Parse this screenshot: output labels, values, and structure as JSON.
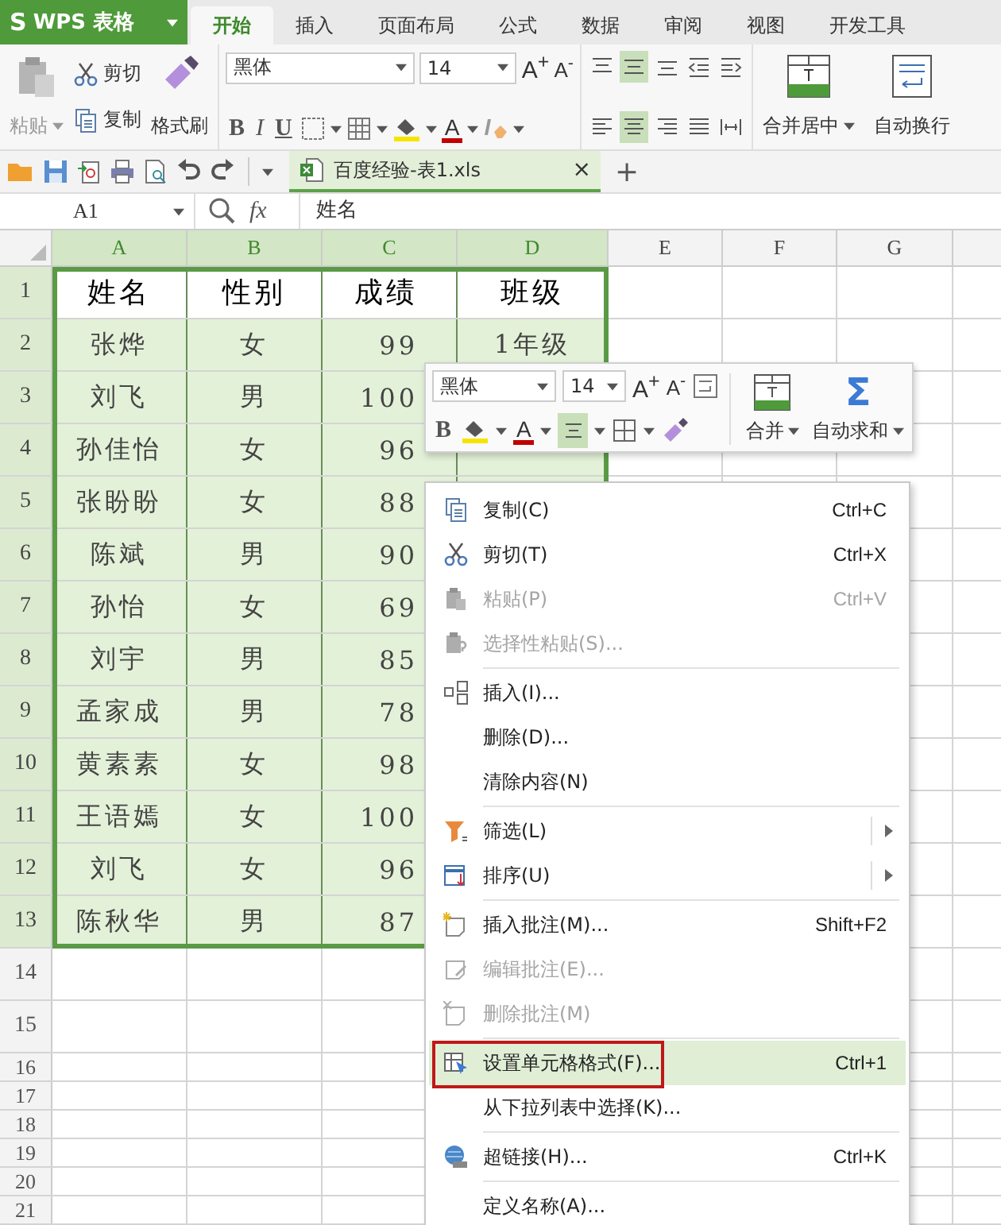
{
  "app_button": {
    "logo": "S",
    "label": "WPS 表格"
  },
  "tabs": [
    {
      "label": "开始",
      "selected": true
    },
    {
      "label": "插入",
      "selected": false
    },
    {
      "label": "页面布局",
      "selected": false
    },
    {
      "label": "公式",
      "selected": false
    },
    {
      "label": "数据",
      "selected": false
    },
    {
      "label": "审阅",
      "selected": false
    },
    {
      "label": "视图",
      "selected": false
    },
    {
      "label": "开发工具",
      "selected": false
    }
  ],
  "ribbon": {
    "paste": {
      "label": "粘贴",
      "disabled": true
    },
    "cut": "剪切",
    "copy": "复制",
    "format_painter": "格式刷",
    "font_name": "黑体",
    "font_size": "14",
    "grow": "A$^{+}$",
    "shrink": "A$^{-}$",
    "bold": "B",
    "italic": "I",
    "underline": "U",
    "font_color": "A",
    "align_top": [
      {
        "selected": false
      },
      {
        "selected": true
      },
      {
        "selected": false
      },
      {
        "selected": false
      },
      {
        "selected": false
      }
    ],
    "align_bottom": [
      {
        "selected": false
      },
      {
        "selected": true
      },
      {
        "selected": false
      },
      {
        "selected": false
      },
      {
        "selected": false
      }
    ],
    "merge": "合并居中",
    "wrap": "自动换行"
  },
  "quick_toolbar": {
    "document_tab": {
      "title": "百度经验-表1.xls",
      "close": "×"
    },
    "new_tab": "+"
  },
  "formula_bar": {
    "cell": "A1",
    "fx": "fx",
    "value": "姓名"
  },
  "sheet": {
    "columns": [
      {
        "label": "A",
        "selected": true
      },
      {
        "label": "B",
        "selected": true
      },
      {
        "label": "C",
        "selected": true
      },
      {
        "label": "D",
        "selected": true
      },
      {
        "label": "E",
        "selected": false
      },
      {
        "label": "F",
        "selected": false
      },
      {
        "label": "G",
        "selected": false
      }
    ],
    "rows": [
      {
        "header": "1",
        "selected": true,
        "kind": "heading",
        "cells": [
          "姓名",
          "性别",
          "成绩",
          "班级"
        ]
      },
      {
        "header": "2",
        "selected": true,
        "kind": "data",
        "cells": [
          "张烨",
          "女",
          "99",
          "1年级"
        ]
      },
      {
        "header": "3",
        "selected": true,
        "kind": "data",
        "cells": [
          "刘飞",
          "男",
          "100"
        ]
      },
      {
        "header": "4",
        "selected": true,
        "kind": "data",
        "cells": [
          "孙佳怡",
          "女",
          "96"
        ]
      },
      {
        "header": "5",
        "selected": true,
        "kind": "data",
        "cells": [
          "张盼盼",
          "女",
          "88"
        ]
      },
      {
        "header": "6",
        "selected": true,
        "kind": "data",
        "cells": [
          "陈斌",
          "男",
          "90"
        ]
      },
      {
        "header": "7",
        "selected": true,
        "kind": "data",
        "cells": [
          "孙怡",
          "女",
          "69"
        ]
      },
      {
        "header": "8",
        "selected": true,
        "kind": "data",
        "cells": [
          "刘宇",
          "男",
          "85"
        ]
      },
      {
        "header": "9",
        "selected": true,
        "kind": "data",
        "cells": [
          "孟家成",
          "男",
          "78"
        ]
      },
      {
        "header": "10",
        "selected": true,
        "kind": "data",
        "cells": [
          "黄素素",
          "女",
          "98"
        ]
      },
      {
        "header": "11",
        "selected": true,
        "kind": "data",
        "cells": [
          "王语嫣",
          "女",
          "100"
        ]
      },
      {
        "header": "12",
        "selected": true,
        "kind": "data",
        "cells": [
          "刘飞",
          "女",
          "96"
        ]
      },
      {
        "header": "13",
        "selected": true,
        "kind": "data",
        "cells": [
          "陈秋华",
          "男",
          "87"
        ]
      },
      {
        "header": "14",
        "selected": false,
        "kind": "tall"
      },
      {
        "header": "15",
        "selected": false,
        "kind": "tall"
      },
      {
        "header": "16",
        "selected": false,
        "kind": "short"
      },
      {
        "header": "17",
        "selected": false,
        "kind": "short"
      },
      {
        "header": "18",
        "selected": false,
        "kind": "short"
      },
      {
        "header": "19",
        "selected": false,
        "kind": "short"
      },
      {
        "header": "20",
        "selected": false,
        "kind": "short"
      },
      {
        "header": "21",
        "selected": false,
        "kind": "short"
      }
    ]
  },
  "mini_toolbar": {
    "font_name": "黑体",
    "font_size": "14",
    "grow": "A$^{+}$",
    "shrink": "A$^{-}$",
    "bold": "B",
    "font_color": "A",
    "align_selected": true,
    "merge": "合并",
    "sigma": "Σ",
    "autosum": "自动求和"
  },
  "context_menu": [
    {
      "kind": "item",
      "label": "复制(C)",
      "shortcut": "Ctrl+C",
      "disabled": false
    },
    {
      "kind": "item",
      "label": "剪切(T)",
      "shortcut": "Ctrl+X",
      "disabled": false
    },
    {
      "kind": "item",
      "label": "粘贴(P)",
      "shortcut": "Ctrl+V",
      "disabled": true
    },
    {
      "kind": "item",
      "label": "选择性粘贴(S)...",
      "disabled": true
    },
    {
      "kind": "separator"
    },
    {
      "kind": "item",
      "label": "插入(I)...",
      "disabled": false
    },
    {
      "kind": "item",
      "label": "删除(D)...",
      "disabled": false
    },
    {
      "kind": "item",
      "label": "清除内容(N)",
      "disabled": false
    },
    {
      "kind": "separator"
    },
    {
      "kind": "item",
      "label": "筛选(L)",
      "disabled": false,
      "submenu": true
    },
    {
      "kind": "item",
      "label": "排序(U)",
      "disabled": false,
      "submenu": true
    },
    {
      "kind": "separator"
    },
    {
      "kind": "item",
      "label": "插入批注(M)...",
      "shortcut": "Shift+F2",
      "disabled": false
    },
    {
      "kind": "item",
      "label": "编辑批注(E)...",
      "disabled": true
    },
    {
      "kind": "item",
      "label": "删除批注(M)",
      "disabled": true
    },
    {
      "kind": "separator"
    },
    {
      "kind": "item",
      "label": "设置单元格格式(F)...",
      "shortcut": "Ctrl+1",
      "disabled": false,
      "selected": true,
      "outlined": true
    },
    {
      "kind": "item",
      "label": "从下拉列表中选择(K)...",
      "disabled": false
    },
    {
      "kind": "separator"
    },
    {
      "kind": "item",
      "label": "超链接(H)...",
      "shortcut": "Ctrl+K",
      "disabled": false
    },
    {
      "kind": "separator"
    },
    {
      "kind": "item",
      "label": "定义名称(A)...",
      "disabled": false
    }
  ]
}
